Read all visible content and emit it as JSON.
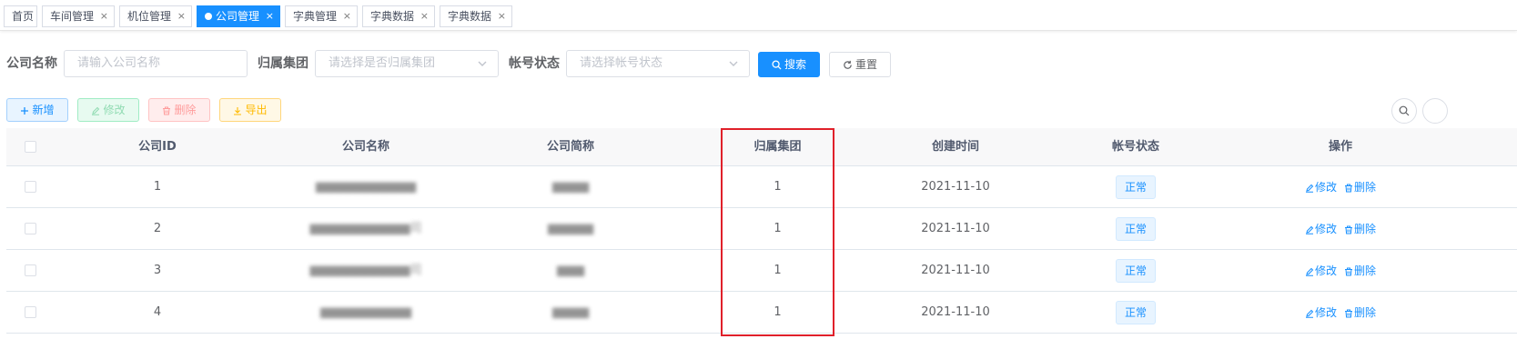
{
  "tabs": [
    {
      "label": "首页",
      "closable": false
    },
    {
      "label": "车间管理",
      "closable": true
    },
    {
      "label": "机位管理",
      "closable": true
    },
    {
      "label": "公司管理",
      "closable": true,
      "active": true
    },
    {
      "label": "字典管理",
      "closable": true
    },
    {
      "label": "字典数据",
      "closable": true
    },
    {
      "label": "字典数据",
      "closable": true
    }
  ],
  "tab_close_glyph": "×",
  "search": {
    "company_name_label": "公司名称",
    "company_name_placeholder": "请输入公司名称",
    "group_label": "归属集团",
    "group_placeholder": "请选择是否归属集团",
    "status_label": "帐号状态",
    "status_placeholder": "请选择帐号状态",
    "search_button": "搜索",
    "reset_button": "重置"
  },
  "toolbar": {
    "add": "新增",
    "edit": "修改",
    "delete": "删除",
    "export": "导出"
  },
  "table": {
    "headers": {
      "id": "公司ID",
      "name": "公司名称",
      "short": "公司简称",
      "group": "归属集团",
      "created": "创建时间",
      "status": "帐号状态",
      "actions": "操作"
    },
    "rows": [
      {
        "id": "1",
        "name": "▆▆▆▆▆▆▆▆▆▆▆",
        "short": "▆▆▆▆",
        "group": "1",
        "created": "2021-11-10",
        "status": "正常"
      },
      {
        "id": "2",
        "name": "▆▆▆▆▆▆▆▆▆▆▆司",
        "short": "▆▆▆▆▆",
        "group": "1",
        "created": "2021-11-10",
        "status": "正常"
      },
      {
        "id": "3",
        "name": "▆▆▆▆▆▆▆▆▆▆▆司",
        "short": "▆▆▆",
        "group": "1",
        "created": "2021-11-10",
        "status": "正常"
      },
      {
        "id": "4",
        "name": "▆▆▆▆▆▆▆▆▆▆",
        "short": "▆▆▆▆",
        "group": "1",
        "created": "2021-11-10",
        "status": "正常"
      }
    ],
    "row_edit": "修改",
    "row_delete": "删除"
  },
  "colors": {
    "primary": "#1890ff",
    "highlight_box": "#e0202a",
    "success": "#13ce66",
    "danger": "#ff4949",
    "warning": "#ffba00"
  },
  "icons": [
    "close-icon",
    "chevron-down-icon",
    "search-icon",
    "refresh-icon",
    "plus-icon",
    "edit-icon",
    "delete-icon",
    "download-icon"
  ]
}
